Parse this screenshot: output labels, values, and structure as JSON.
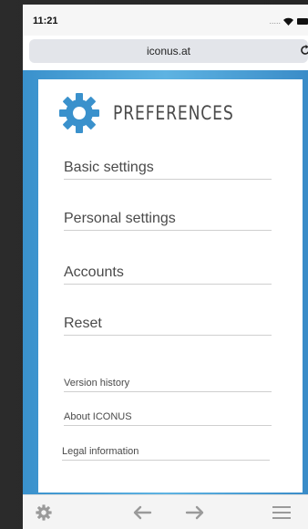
{
  "status_bar": {
    "time": "11:21",
    "signal_dots": "....."
  },
  "browser": {
    "url": "iconus.at"
  },
  "page": {
    "title": "PREFERENCES",
    "accent_color": "#3a91cc",
    "icon": "gear-icon"
  },
  "menu": {
    "items": [
      {
        "label": "Basic settings"
      },
      {
        "label": "Personal settings"
      },
      {
        "label": "Accounts"
      },
      {
        "label": "Reset"
      }
    ],
    "secondary_items": [
      {
        "label": "Version history"
      },
      {
        "label": "About ICONUS"
      },
      {
        "label": "Legal information"
      }
    ]
  },
  "toolbar": {
    "icons": [
      "gear-icon",
      "back-arrow-icon",
      "forward-arrow-icon",
      "hamburger-menu-icon"
    ]
  }
}
